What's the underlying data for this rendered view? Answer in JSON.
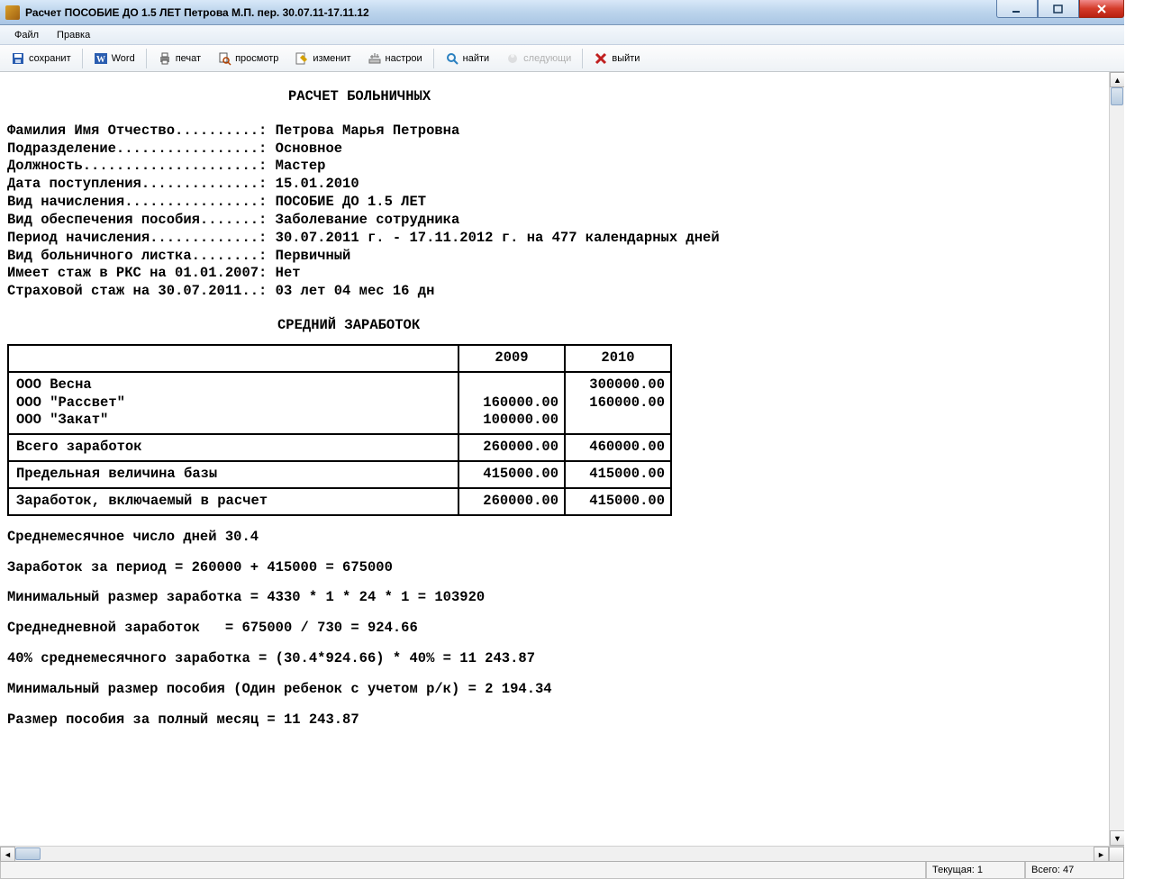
{
  "window": {
    "title": "Расчет ПОСОБИЕ ДО 1.5 ЛЕТ Петрова М.П. пер. 30.07.11-17.11.12"
  },
  "menu": {
    "file": "Файл",
    "edit": "Правка"
  },
  "toolbar": {
    "save": "сохранит",
    "word": "Word",
    "print": "печат",
    "preview": "просмотр",
    "modify": "изменит",
    "settings": "настрои",
    "find": "найти",
    "next": "следующи",
    "exit": "выйти"
  },
  "report": {
    "title": "РАСЧЕТ БОЛЬНИЧНЫХ",
    "lines": [
      "Фамилия Имя Отчество..........: Петрова Марья Петровна",
      "Подразделение.................: Основное",
      "Должность.....................: Мастер",
      "Дата поступления..............: 15.01.2010",
      "Вид начисления................: ПОСОБИЕ ДО 1.5 ЛЕТ",
      "Вид обеспечения пособия.......: Заболевание сотрудника",
      "Период начисления.............: 30.07.2011 г. - 17.11.2012 г. на 477 календарных дней",
      "Вид больничного листка........: Первичный",
      "Имеет стаж в РКС на 01.01.2007: Нет",
      "Страховой стаж на 30.07.2011..: 03 лет 04 мес 16 дн"
    ],
    "section_title": "СРЕДНИЙ  ЗАРАБОТОК",
    "table": {
      "year1": "2009",
      "year2": "2010",
      "rows_block1": [
        {
          "name": "ООО Весна",
          "y1": "",
          "y2": "300000.00"
        },
        {
          "name": "ООО \"Рассвет\"",
          "y1": "160000.00",
          "y2": "160000.00"
        },
        {
          "name": "ООО \"Закат\"",
          "y1": "100000.00",
          "y2": ""
        }
      ],
      "total_label": "Всего заработок",
      "total_y1": "260000.00",
      "total_y2": "460000.00",
      "limit_label": "Предельная величина базы",
      "limit_y1": "415000.00",
      "limit_y2": "415000.00",
      "incl_label": "Заработок, включаемый в расчет",
      "incl_y1": "260000.00",
      "incl_y2": "415000.00"
    },
    "calc": [
      "Среднемесячное число дней 30.4",
      "Заработок за период = 260000 + 415000 = 675000",
      "Минимальный размер заработка = 4330 * 1 * 24 * 1 = 103920",
      "Среднедневной заработок   = 675000 / 730 = 924.66",
      "40% среднемесячного заработка = (30.4*924.66) * 40% = 11 243.87",
      "Минимальный размер пособия (Один ребенок с учетом р/к) = 2 194.34",
      "Размер пособия за полный месяц = 11 243.87"
    ]
  },
  "status": {
    "current_label": "Текущая:",
    "current_value": "1",
    "total_label": "Всего:",
    "total_value": "47"
  }
}
